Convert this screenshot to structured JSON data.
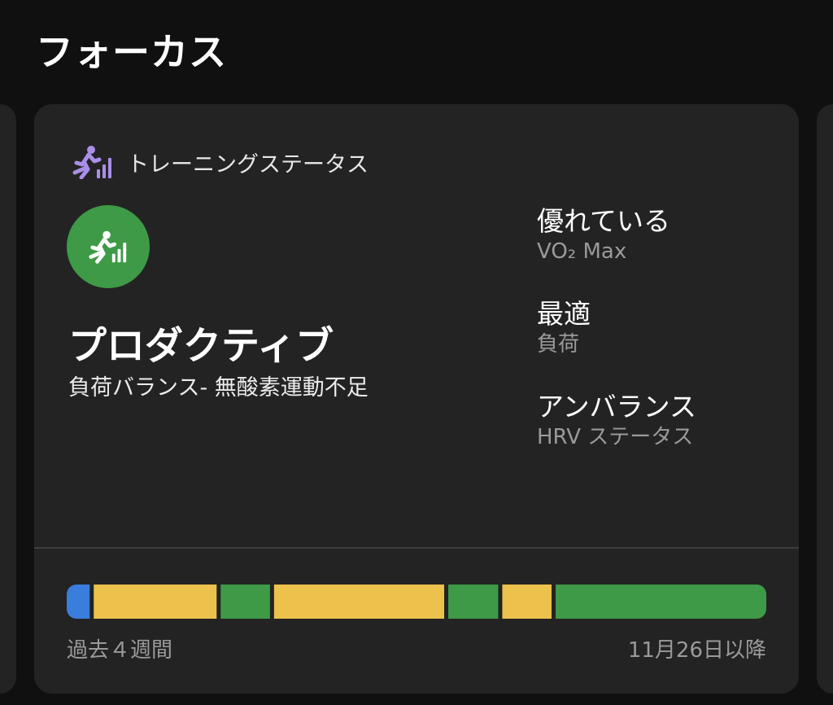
{
  "section": {
    "title": "フォーカス"
  },
  "card": {
    "header_icon": "runner-bars-icon",
    "header_label": "トレーニングステータス",
    "status": {
      "icon": "runner-bars-icon",
      "color": "#3e9a46",
      "title": "プロダクティブ",
      "subtitle": "負荷バランス- 無酸素運動不足"
    },
    "metrics": [
      {
        "value": "優れている",
        "label": "VO₂ Max"
      },
      {
        "value": "最適",
        "label": "負荷"
      },
      {
        "value": "アンバランス",
        "label": "HRV ステータス"
      }
    ],
    "history": {
      "start_label": "過去４週間",
      "end_label": "11月26日以降",
      "segments": [
        {
          "status": "blue",
          "color": "#3b7ddd",
          "share": 0.034
        },
        {
          "status": "yellow",
          "color": "#ecc14c",
          "share": 0.182
        },
        {
          "status": "green",
          "color": "#3e9a46",
          "share": 0.073
        },
        {
          "status": "yellow",
          "color": "#ecc14c",
          "share": 0.252
        },
        {
          "status": "green",
          "color": "#3e9a46",
          "share": 0.074
        },
        {
          "status": "yellow",
          "color": "#ecc14c",
          "share": 0.073
        },
        {
          "status": "green",
          "color": "#3e9a46",
          "share": 0.322
        }
      ]
    }
  }
}
